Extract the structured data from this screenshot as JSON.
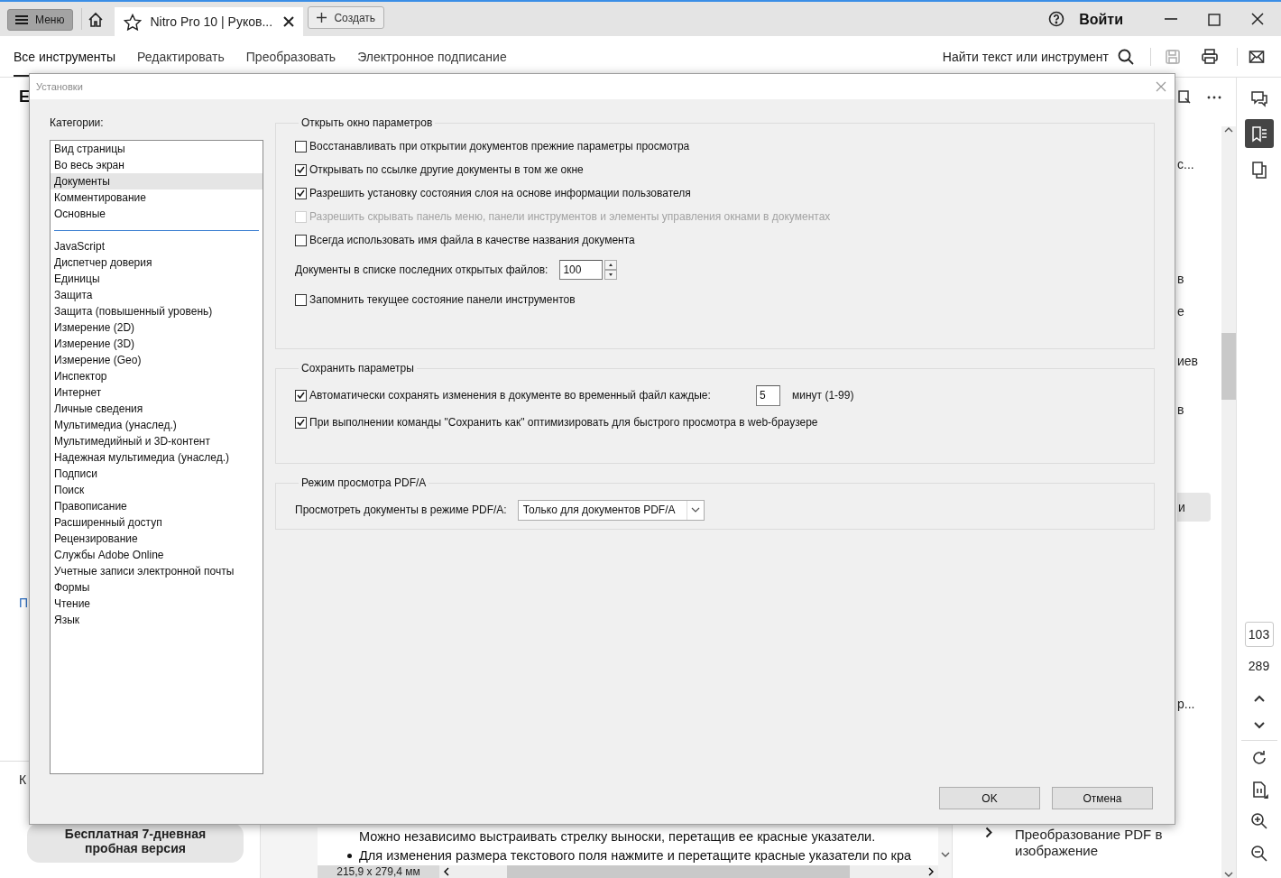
{
  "title_bar": {
    "menu_button": "Меню",
    "tabs": [
      {
        "title": "Nitro Pro 10 | Руков...",
        "selected": true
      }
    ],
    "new_button": "Создать",
    "sign_in": "Войти"
  },
  "toolbar": {
    "tabs": [
      {
        "label": "Все инструменты",
        "selected": true
      },
      {
        "label": "Редактировать",
        "selected": false
      },
      {
        "label": "Преобразовать",
        "selected": false
      },
      {
        "label": "Электронное подписание",
        "selected": false
      }
    ],
    "search_label": "Найти текст или инструмент",
    "actions": [
      {
        "kind": "save",
        "disabled": true
      },
      {
        "kind": "print",
        "disabled": false
      },
      {
        "kind": "email",
        "disabled": false
      }
    ]
  },
  "left_panel": {
    "fragments": [
      {
        "kind": "heading",
        "text": "Е"
      },
      {
        "kind": "link",
        "text": "П"
      },
      {
        "kind": "text",
        "text": "К"
      }
    ],
    "trial_button": "Бесплатная 7-дневная пробная версия"
  },
  "document": {
    "lines": [
      {
        "kind": "text",
        "text": "Можно независимо выстраивать стрелку выноски, перетащив ее красные указатели."
      },
      {
        "kind": "bullet",
        "text": "Для изменения размера текстового поля нажмите и перетащите красные указатели по кра"
      }
    ],
    "page_size": "215,9 x 279,4 мм"
  },
  "right_panel": {
    "fragments": [
      {
        "text": "с...",
        "selected": false
      },
      {
        "text": "в",
        "selected": false
      },
      {
        "text": "е",
        "selected": false
      },
      {
        "text": "иев",
        "selected": false
      },
      {
        "text": "в",
        "selected": false
      },
      {
        "text": "и",
        "selected": true
      },
      {
        "text": "р...",
        "selected": false
      }
    ],
    "items": [
      {
        "text": "Преобразование PDF в изображение"
      }
    ]
  },
  "sidebar": {
    "panels": [
      {
        "kind": "comments",
        "selected": false
      },
      {
        "kind": "bookmarks",
        "selected": true
      },
      {
        "kind": "pages",
        "selected": false
      }
    ],
    "page_number": "103",
    "page_count": "289"
  },
  "dialog": {
    "title": "Установки",
    "categories_label": "Категории:",
    "categories": [
      [
        {
          "label": "Вид страницы",
          "selected": false
        },
        {
          "label": "Во весь экран",
          "selected": false
        },
        {
          "label": "Документы",
          "selected": true
        },
        {
          "label": "Комментирование",
          "selected": false
        },
        {
          "label": "Основные",
          "selected": false
        }
      ],
      [
        {
          "label": "JavaScript",
          "selected": false
        },
        {
          "label": "Диспетчер доверия",
          "selected": false
        },
        {
          "label": "Единицы",
          "selected": false
        },
        {
          "label": "Защита",
          "selected": false
        },
        {
          "label": "Защита (повышенный уровень)",
          "selected": false
        },
        {
          "label": "Измерение (2D)",
          "selected": false
        },
        {
          "label": "Измерение (3D)",
          "selected": false
        },
        {
          "label": "Измерение (Geo)",
          "selected": false
        },
        {
          "label": "Инспектор",
          "selected": false
        },
        {
          "label": "Интернет",
          "selected": false
        },
        {
          "label": "Личные сведения",
          "selected": false
        },
        {
          "label": "Мультимедиа (унаслед.)",
          "selected": false
        },
        {
          "label": "Мультимедийный и 3D-контент",
          "selected": false
        },
        {
          "label": "Надежная мультимедиа (унаслед.)",
          "selected": false
        },
        {
          "label": "Подписи",
          "selected": false
        },
        {
          "label": "Поиск",
          "selected": false
        },
        {
          "label": "Правописание",
          "selected": false
        },
        {
          "label": "Расширенный доступ",
          "selected": false
        },
        {
          "label": "Рецензирование",
          "selected": false
        },
        {
          "label": "Службы Adobe Online",
          "selected": false
        },
        {
          "label": "Учетные записи электронной почты",
          "selected": false
        },
        {
          "label": "Формы",
          "selected": false
        },
        {
          "label": "Чтение",
          "selected": false
        },
        {
          "label": "Язык",
          "selected": false
        }
      ]
    ],
    "groups": [
      {
        "title": "Открыть окно параметров",
        "options": [
          {
            "kind": "checkbox",
            "label": "Восстанавливать при открытии документов прежние параметры просмотра",
            "checked": false,
            "disabled": false
          },
          {
            "kind": "checkbox",
            "label": "Открывать по ссылке другие документы в том же окне",
            "checked": true,
            "disabled": false
          },
          {
            "kind": "checkbox",
            "label": "Разрешить установку состояния слоя на основе информации пользователя",
            "checked": true,
            "disabled": false
          },
          {
            "kind": "checkbox",
            "label": "Разрешить скрывать панель меню, панели инструментов и элементы управления окнами в документах",
            "checked": false,
            "disabled": true
          },
          {
            "kind": "checkbox",
            "label": "Всегда использовать имя файла в качестве названия документа",
            "checked": false,
            "disabled": false
          },
          {
            "kind": "number",
            "label": "Документы в списке последних открытых файлов:",
            "value": "100"
          },
          {
            "kind": "checkbox",
            "label": "Запомнить текущее состояние панели инструментов",
            "checked": false,
            "disabled": false
          }
        ]
      },
      {
        "title": "Сохранить параметры",
        "options": [
          {
            "kind": "checkbox-number",
            "label": "Автоматически сохранять изменения в документе во временный файл каждые:",
            "checked": true,
            "disabled": false,
            "value": "5",
            "unit": "минут (1-99)"
          },
          {
            "kind": "checkbox",
            "label": "При выполнении команды \"Сохранить как\" оптимизировать для быстрого просмотра в web-браузере",
            "checked": true,
            "disabled": false
          }
        ]
      },
      {
        "title": "Режим просмотра PDF/A",
        "options": [
          {
            "kind": "select",
            "label": "Просмотреть документы в режиме PDF/A:",
            "value": "Только для документов PDF/A"
          }
        ]
      }
    ],
    "buttons": [
      "OK",
      "Отмена"
    ]
  }
}
